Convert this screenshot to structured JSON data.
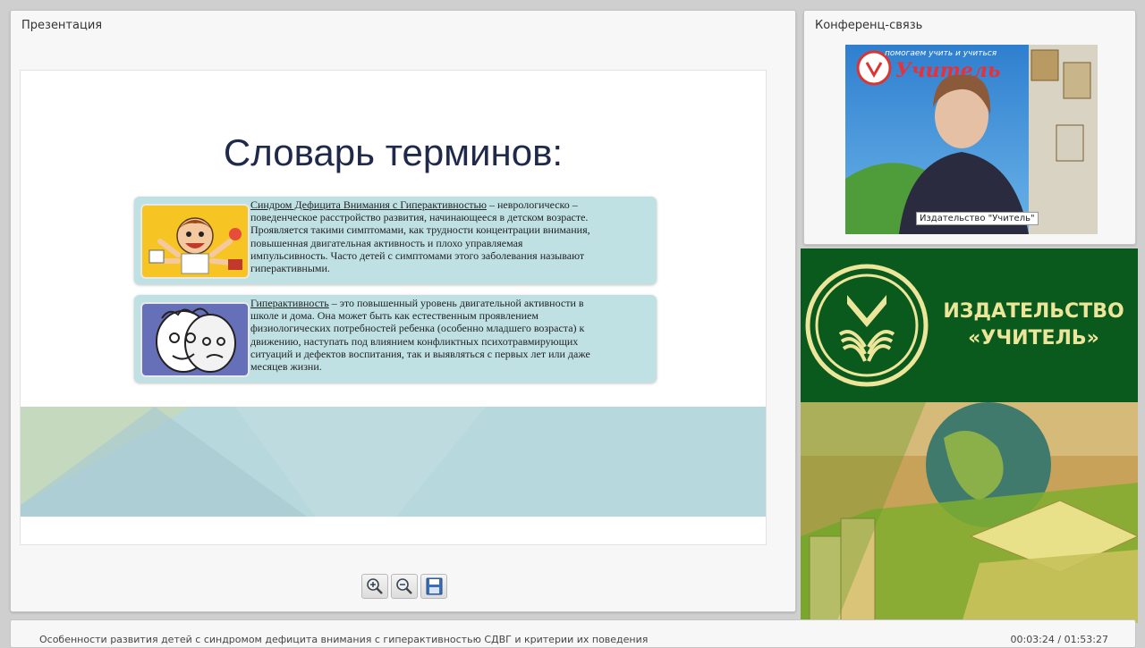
{
  "presentation_panel": {
    "title": "Презентация"
  },
  "slide": {
    "heading": "Словарь терминов:",
    "terms": [
      {
        "term": "Синдром Дефицита Внимания с Гиперактивностью",
        "definition_lines": [
          "  – неврологическо –",
          "поведенческое расстройство развития, начинающееся в детском возрасте.",
          "Проявляется такими симптомами, как трудности концентрации внимания,",
          "повышенная двигательная активность и плохо управляемая",
          "импульсивность. Часто детей с симптомами этого заболевания называют",
          "гиперактивными."
        ]
      },
      {
        "term": "Гиперактивность",
        "definition_lines": [
          " – это повышенный уровень двигательной активности в",
          "школе и дома. Она может быть как естественным проявлением",
          "физиологических потребностей ребенка (особенно младшего возраста) к",
          "движению, наступать под влиянием конфликтных психотравмирующих",
          "ситуаций и дефектов воспитания, так и выявляться с первых лет или даже",
          "месяцев жизни."
        ]
      }
    ]
  },
  "toolbar": {
    "zoom_in_icon": "zoom-in-icon",
    "zoom_out_icon": "zoom-out-icon",
    "save_icon": "save-icon"
  },
  "conference_panel": {
    "title": "Конференц-связь",
    "video": {
      "participant_label": "Издательство \"Учитель\"",
      "backdrop_top_text": "помогаем учить и учиться",
      "backdrop_logo_text": "Учитель"
    }
  },
  "banner": {
    "publisher_line1": "ИЗДАТЕЛЬСТВО",
    "publisher_line2": "«УЧИТЕЛЬ»",
    "colors": {
      "green": "#0a5a1e",
      "text": "#ede69a"
    }
  },
  "statusbar": {
    "webinar_title": "Особенности развития детей с синдромом дефицита внимания с гиперактивностью СДВГ и критерии их поведения",
    "time": "00:03:24 / 01:53:27"
  }
}
